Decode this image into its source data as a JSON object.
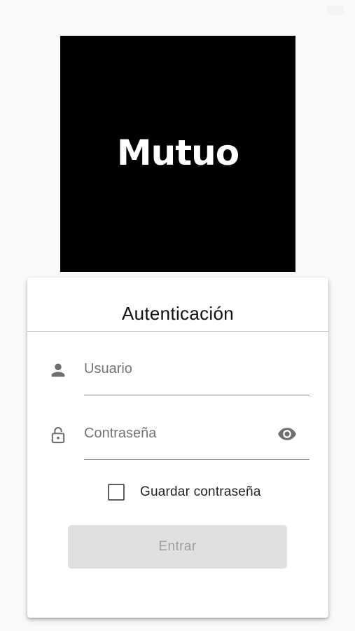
{
  "logo": {
    "text": "Mutuo"
  },
  "login_card": {
    "title": "Autenticación",
    "username": {
      "placeholder": "Usuario",
      "value": "",
      "icon": "person-icon"
    },
    "password": {
      "placeholder": "Contraseña",
      "value": "",
      "icon": "lock-icon",
      "toggle_icon": "eye-icon"
    },
    "remember": {
      "label": "Guardar contraseña",
      "checked": false
    },
    "submit": {
      "label": "Entrar",
      "enabled": false
    }
  },
  "colors": {
    "logo_background": "#000000",
    "logo_text": "#ffffff",
    "icon_gray": "#6f6f6f",
    "button_disabled_bg": "#e0e0e0",
    "button_disabled_text": "#9e9e9e"
  }
}
